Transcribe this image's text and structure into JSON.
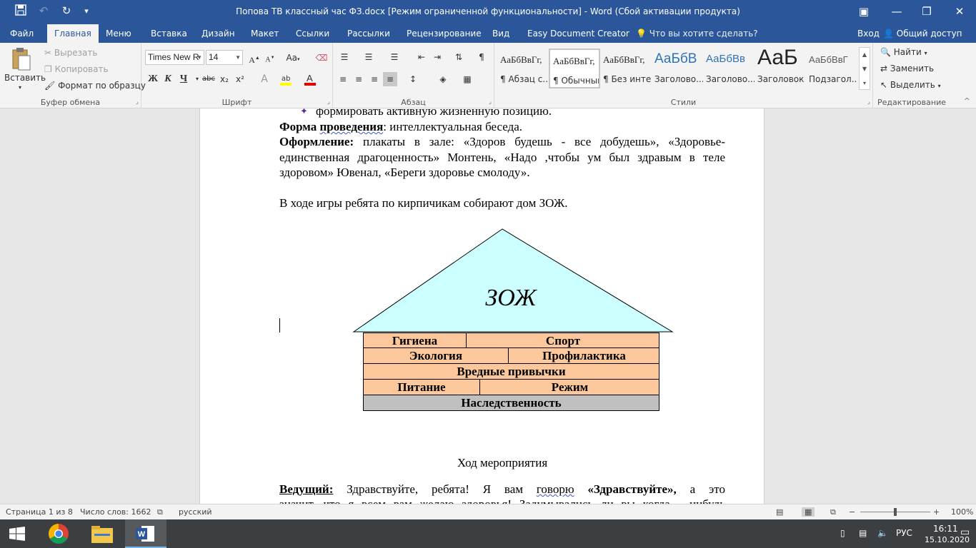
{
  "window": {
    "title": "Попова ТВ классный час ФЗ.docx [Режим ограниченной функциональности] - Word (Сбой активации продукта)",
    "quick_access": [
      "save-icon",
      "undo-icon",
      "redo-icon",
      "customize-icon"
    ]
  },
  "menu": {
    "tabs": [
      "Файл",
      "Главная",
      "Меню",
      "Вставка",
      "Дизайн",
      "Макет",
      "Ссылки",
      "Рассылки",
      "Рецензирование",
      "Вид",
      "Easy Document Creator"
    ],
    "active_tab": "Главная",
    "tell_me": "Что вы хотите сделать?",
    "login": "Вход",
    "share": "Общий доступ"
  },
  "ribbon": {
    "clipboard": {
      "paste": "Вставить",
      "cut": "Вырезать",
      "copy": "Копировать",
      "format_painter": "Формат по образцу",
      "label": "Буфер обмена"
    },
    "font": {
      "name": "Times New R",
      "size": "14",
      "label": "Шрифт",
      "bold": "Ж",
      "italic": "К",
      "underline": "Ч",
      "strike": "abc",
      "subscript": "x₂",
      "superscript": "x²",
      "grow": "A",
      "shrink": "A",
      "case": "Aa"
    },
    "paragraph": {
      "label": "Абзац"
    },
    "styles": {
      "label": "Стили",
      "items": [
        {
          "sample": "АаБбВвГг,",
          "name": "¶ Абзац с..."
        },
        {
          "sample": "АаБбВвГг,",
          "name": "¶ Обычный"
        },
        {
          "sample": "АаБбВвГг,",
          "name": "¶ Без инте..."
        },
        {
          "sample": "АаБбВ",
          "name": "Заголово..."
        },
        {
          "sample": "АаБбВв",
          "name": "Заголово..."
        },
        {
          "sample": "АаБ",
          "name": "Заголовок"
        },
        {
          "sample": "АаБбВвГ",
          "name": "Подзагол..."
        }
      ],
      "selected_index": 1
    },
    "editing": {
      "label": "Редактирование",
      "find": "Найти",
      "replace": "Заменить",
      "select": "Выделить"
    }
  },
  "document": {
    "bullet_line": "формировать активную жизненную позицию.",
    "form_label": "Форма",
    "form_label2": "проведения",
    "form_value": ":  интеллектуальная беседа.",
    "design_label": "Оформление:",
    "design_text_1": " плакаты в зале: «Здоров будешь - все добудешь»,  «Здоровье-",
    "design_text_2": "единственная драгоценность» Монтень, «Надо ,чтобы ум был здравым в теле",
    "design_text_3": "здоровом» Ювенал,  «Береги здоровье смолоду».",
    "game_text": "В ходе игры ребята по кирпичикам собирают дом ЗОЖ.",
    "roof_label": "ЗОЖ",
    "bricks": [
      [
        "Гигиена",
        "Спорт"
      ],
      [
        "Экология",
        "Профилактика"
      ],
      [
        "Вредные привычки"
      ],
      [
        "Питание",
        "Режим"
      ],
      [
        "Наследственность"
      ]
    ],
    "event_heading": "Ход мероприятия",
    "host_label": "Ведущий:",
    "host_text_a": "   Здравствуйте,  ребята!  Я  вам  ",
    "host_text_b": "говорю",
    "host_text_c": "  «Здравствуйте»,",
    "host_text_d": "  а  это",
    "cutoff_line": "значит, что я всем вам желаю здоровья! Задумывались ли вы когда - нибудь"
  },
  "status": {
    "page": "Страница 1 из 8",
    "words": "Число слов: 1662",
    "language": "русский",
    "zoom": "100%",
    "zoom_fraction": 0.5
  },
  "taskbar": {
    "lang": "РУС",
    "time": "16:11",
    "date": "15.10.2020"
  },
  "colors": {
    "accent": "#2b579a",
    "roof_fill": "#ccffff",
    "brick_fill": "#fcc89b",
    "foundation_fill": "#c0c0c0"
  }
}
